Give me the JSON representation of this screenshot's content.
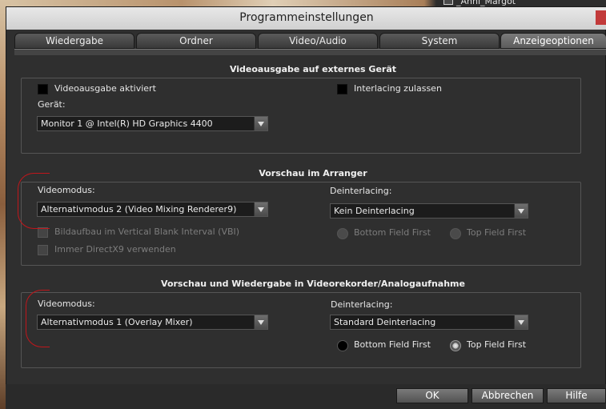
{
  "background": {
    "file_label": "_Anni_Margot"
  },
  "dialog": {
    "title": "Programmeinstellungen"
  },
  "tabs": [
    {
      "label": "Wiedergabe"
    },
    {
      "label": "Ordner"
    },
    {
      "label": "Video/Audio"
    },
    {
      "label": "System"
    },
    {
      "label": "Anzeigeoptionen",
      "active": true
    }
  ],
  "external_output": {
    "title": "Videoausgabe auf externes Gerät",
    "enable_output_label": "Videoausgabe aktiviert",
    "enable_output_checked": false,
    "interlacing_label": "Interlacing zulassen",
    "interlacing_checked": false,
    "device_label": "Gerät:",
    "device_value": "Monitor 1 @ Intel(R) HD Graphics 4400"
  },
  "arranger_preview": {
    "title": "Vorschau im Arranger",
    "videomode_label": "Videomodus:",
    "videomode_value": "Alternativmodus 2 (Video Mixing Renderer9)",
    "deinterlacing_label": "Deinterlacing:",
    "deinterlacing_value": "Kein Deinterlacing",
    "vbi_label": "Bildaufbau im Vertical Blank Interval (VBI)",
    "directx9_label": "Immer DirectX9 verwenden",
    "bottom_field_label": "Bottom Field First",
    "top_field_label": "Top Field First"
  },
  "recorder_preview": {
    "title": "Vorschau und Wiedergabe in Videorekorder/Analogaufnahme",
    "videomode_label": "Videomodus:",
    "videomode_value": "Alternativmodus 1 (Overlay Mixer)",
    "deinterlacing_label": "Deinterlacing:",
    "deinterlacing_value": "Standard Deinterlacing",
    "bottom_field_label": "Bottom Field First",
    "top_field_label": "Top Field First",
    "selected_field": "Top Field First"
  },
  "buttons": {
    "ok": "OK",
    "cancel": "Abbrechen",
    "help": "Hilfe"
  },
  "colors": {
    "annotation": "#c0161b",
    "dialog_bg": "#2f2f2f"
  }
}
